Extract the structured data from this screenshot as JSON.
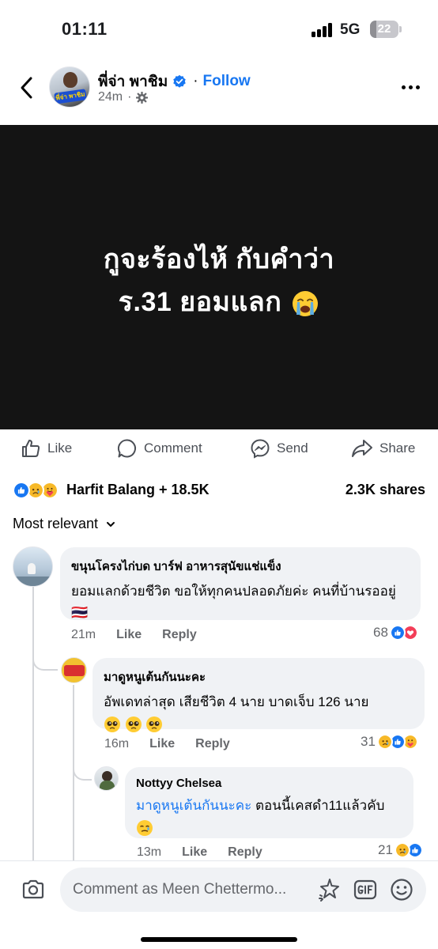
{
  "status_bar": {
    "time": "01:11",
    "network": "5G",
    "battery": "22",
    "battery_level_percent": 22
  },
  "post": {
    "author": "พี่จ่า พาชิม",
    "verified": true,
    "separator": "·",
    "follow_label": "Follow",
    "time_ago": "24m",
    "privacy_icon": "gear-icon",
    "avatar_badge": "พี่จ่า พาชิม",
    "image_text": {
      "line1": "กูจะร้องไห้ กับคำว่า",
      "line2": "ร.31 ยอมแลก",
      "emoji": "loudly-crying-face"
    }
  },
  "actions": {
    "like": "Like",
    "comment": "Comment",
    "send": "Send",
    "share": "Share"
  },
  "reactions": {
    "icons": [
      "like",
      "sad",
      "care"
    ],
    "summary": "Harfit Balang + 18.5K",
    "shares": "2.3K shares"
  },
  "sort": {
    "label": "Most relevant"
  },
  "comments": [
    {
      "author": "ขนุนโครงไก่บด บาร์ฟ อาหารสุนัขแช่แข็ง",
      "text": "ยอมแลกด้วยชีวิต ขอให้ทุกคนปลอดภัยค่ะ คนที่บ้านรออยู่🇹🇭",
      "time": "21m",
      "like_label": "Like",
      "reply_label": "Reply",
      "reaction_count": "68",
      "reaction_icons": [
        "like",
        "love"
      ]
    },
    {
      "author": "มาดูหนูเต้นกันนะคะ",
      "text": "อัพเดทล่าสุด เสียชีวิต  4  นาย  บาดเจ็บ  126 นาย",
      "emojis": [
        "pleading-face",
        "pleading-face",
        "pleading-face"
      ],
      "time": "16m",
      "like_label": "Like",
      "reply_label": "Reply",
      "reaction_count": "31",
      "reaction_icons": [
        "sad",
        "like",
        "care"
      ]
    },
    {
      "author": "Nottyy Chelsea",
      "mention": "มาดูหนูเต้นกันนะคะ",
      "text": " ตอนนี้เคสดำ11แล้วคับ",
      "emojis": [
        "tearful-smile"
      ],
      "time": "13m",
      "like_label": "Like",
      "reply_label": "Reply",
      "reaction_count": "21",
      "reaction_icons": [
        "sad",
        "like"
      ]
    }
  ],
  "composer": {
    "placeholder": "Comment as Meen Chettermo..."
  },
  "colors": {
    "brand_blue": "#1877f2",
    "image_bg": "#141414",
    "bubble_bg": "#f0f2f5",
    "secondary_text": "#65676b"
  }
}
